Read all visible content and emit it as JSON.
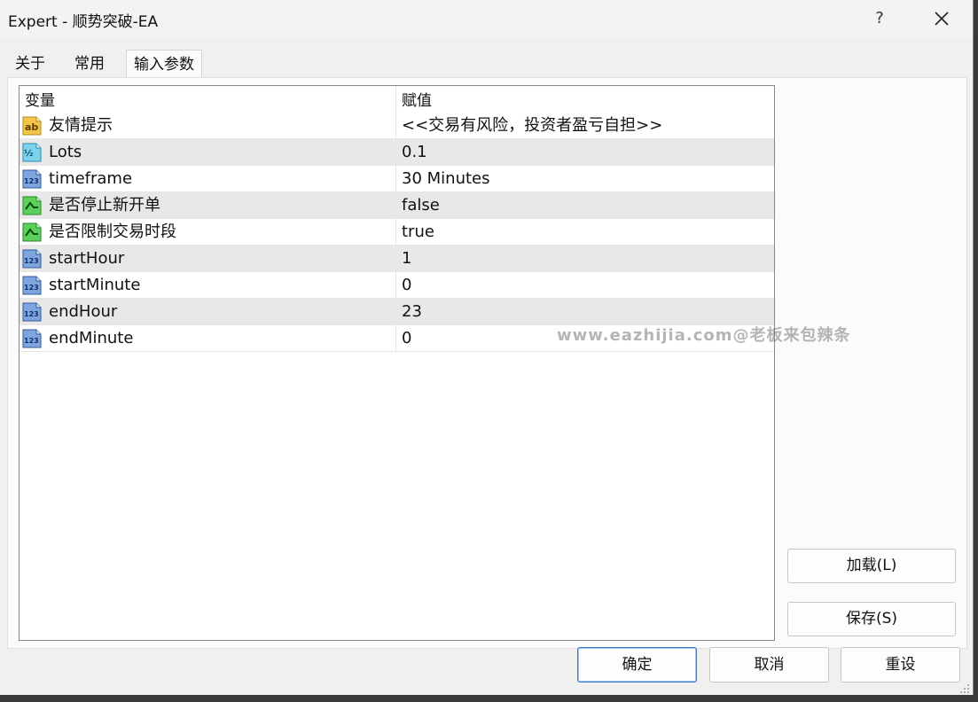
{
  "window": {
    "title": "Expert - 顺势突破-EA",
    "help_label": "?"
  },
  "tabs": [
    {
      "label": "关于"
    },
    {
      "label": "常用"
    },
    {
      "label": "输入参数"
    }
  ],
  "table": {
    "headers": {
      "variable": "变量",
      "value": "赋值"
    },
    "rows": [
      {
        "name": "友情提示",
        "value": "<<交易有风险，投资者盈亏自担>>",
        "icon": "string-ab-icon"
      },
      {
        "name": "Lots",
        "value": "0.1",
        "icon": "double-fraction-icon"
      },
      {
        "name": "timeframe",
        "value": "30 Minutes",
        "icon": "integer-123-icon"
      },
      {
        "name": "是否停止新开单",
        "value": "false",
        "icon": "boolean-icon"
      },
      {
        "name": "是否限制交易时段",
        "value": "true",
        "icon": "boolean-icon"
      },
      {
        "name": "startHour",
        "value": "1",
        "icon": "integer-123-icon"
      },
      {
        "name": "startMinute",
        "value": "0",
        "icon": "integer-123-icon"
      },
      {
        "name": "endHour",
        "value": "23",
        "icon": "integer-123-icon"
      },
      {
        "name": "endMinute",
        "value": "0",
        "icon": "integer-123-icon"
      }
    ]
  },
  "watermark": "www.eazhijia.com@老板来包辣条",
  "side_buttons": {
    "load": "加载(L)",
    "save": "保存(S)"
  },
  "footer_buttons": {
    "ok": "确定",
    "cancel": "取消",
    "reset": "重设"
  },
  "colors": {
    "primary_button_border": "#3d7bc7",
    "alt_row": "#e8e8e8"
  }
}
